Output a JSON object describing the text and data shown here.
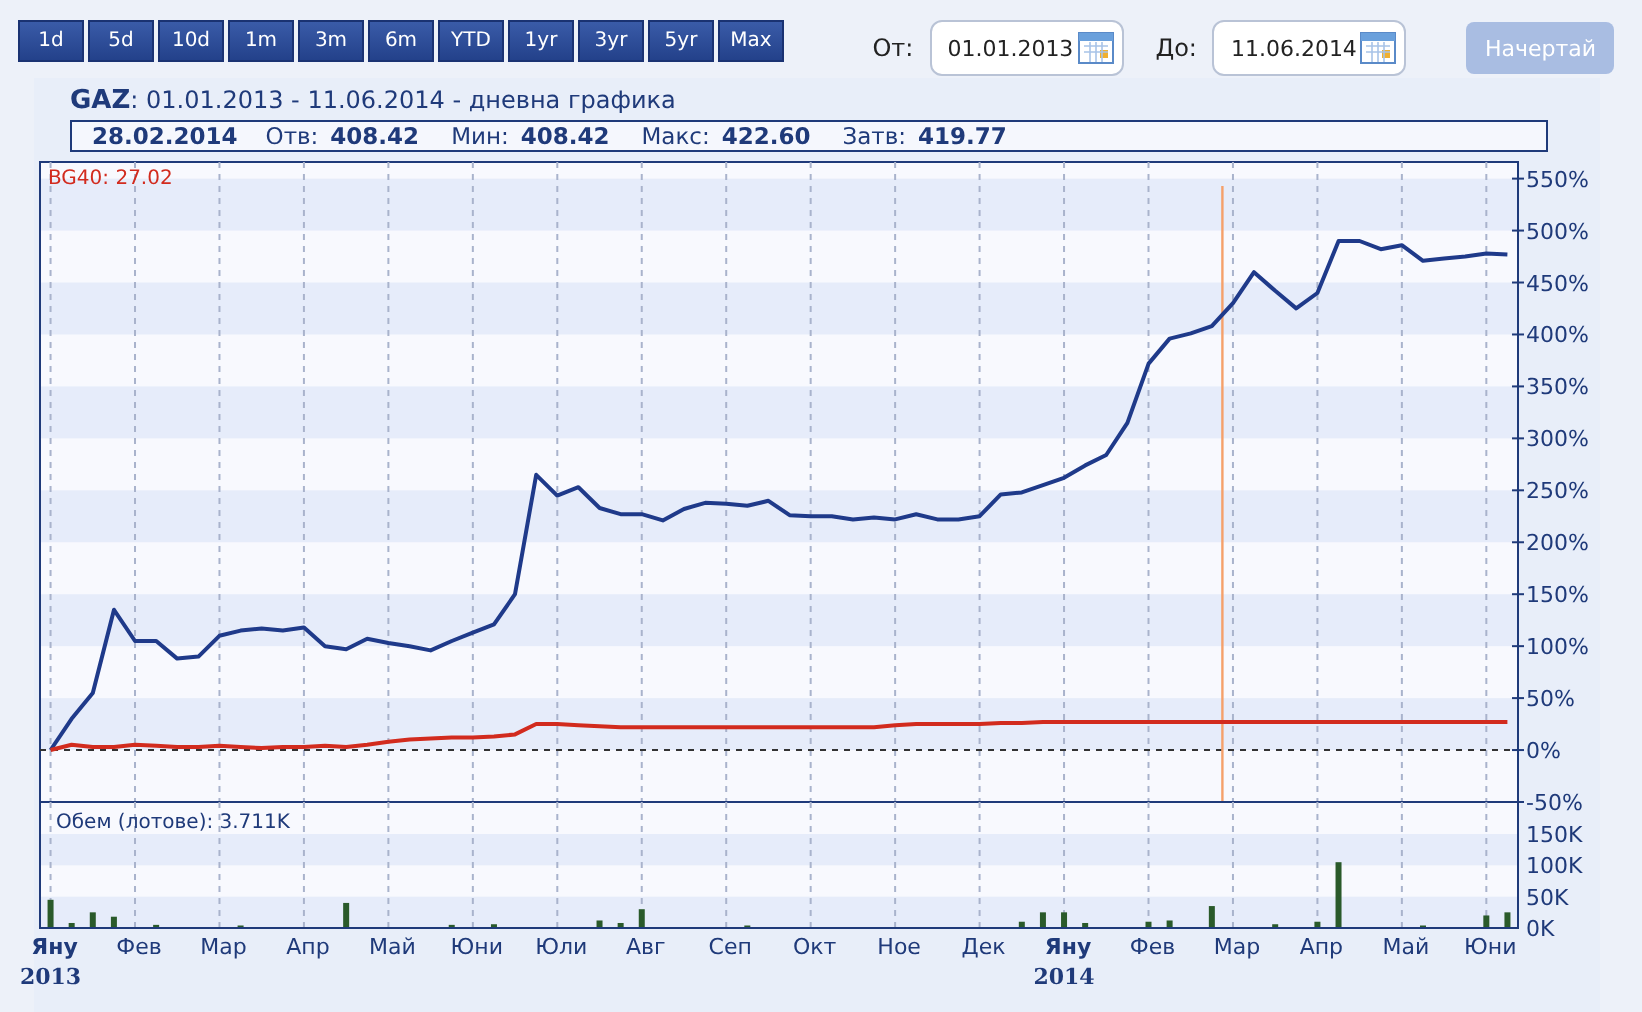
{
  "periods": [
    {
      "label": "1d",
      "selected": false
    },
    {
      "label": "5d",
      "selected": false
    },
    {
      "label": "10d",
      "selected": false
    },
    {
      "label": "1m",
      "selected": false
    },
    {
      "label": "3m",
      "selected": false
    },
    {
      "label": "6m",
      "selected": false
    },
    {
      "label": "YTD",
      "selected": false
    },
    {
      "label": "1yr",
      "selected": false
    },
    {
      "label": "3yr",
      "selected": false
    },
    {
      "label": "5yr",
      "selected": false
    },
    {
      "label": "Max",
      "selected": false
    }
  ],
  "date_from": {
    "label": "От:",
    "value": "01.01.2013"
  },
  "date_to": {
    "label": "До:",
    "value": "11.06.2014"
  },
  "draw_button": {
    "label": "Начертай",
    "disabled": true
  },
  "title_suffix": ": 01.01.2013 - 11.06.2014 - дневна графика",
  "info": {
    "date": "28.02.2014",
    "fields": [
      {
        "label": "Отв:",
        "value": "408.42"
      },
      {
        "label": "Мин:",
        "value": "408.42"
      },
      {
        "label": "Макс:",
        "value": "422.60"
      },
      {
        "label": "Затв:",
        "value": "419.77"
      }
    ]
  },
  "legend": {
    "value": ": 27.02"
  },
  "volume_legend": "Обем (лотове): 3.711K",
  "years": [
    "2013",
    "2014"
  ],
  "price_chart": {
    "chart_data": {
      "type": "line",
      "ylim": [
        -50,
        566
      ],
      "categories": [
        "Яну",
        null,
        null,
        null,
        "Фев",
        null,
        null,
        null,
        "Мар",
        null,
        null,
        null,
        "Апр",
        null,
        null,
        null,
        "Май",
        null,
        null,
        null,
        "Юни",
        null,
        null,
        null,
        "Юли",
        null,
        null,
        null,
        "Авг",
        null,
        null,
        null,
        "Сеп",
        null,
        null,
        null,
        "Окт",
        null,
        null,
        null,
        "Ное",
        null,
        null,
        null,
        "Дек",
        null,
        null,
        null,
        "Яну",
        null,
        null,
        null,
        "Фев",
        null,
        null,
        null,
        "Мар",
        null,
        null,
        null,
        "Апр",
        null,
        null,
        null,
        "Май",
        null,
        null,
        null,
        "Юни",
        null
      ],
      "yticks": [
        {
          "value": 550,
          "label": "550%"
        },
        {
          "value": 500,
          "label": "500%"
        },
        {
          "value": 450,
          "label": "450%"
        },
        {
          "value": 400,
          "label": "400%"
        },
        {
          "value": 350,
          "label": "350%"
        },
        {
          "value": 300,
          "label": "300%"
        },
        {
          "value": 250,
          "label": "250%"
        },
        {
          "value": 200,
          "label": "200%"
        },
        {
          "value": 150,
          "label": "150%"
        },
        {
          "value": 100,
          "label": "100%"
        },
        {
          "value": 50,
          "label": "50%"
        },
        {
          "value": 0,
          "label": "0%"
        },
        {
          "value": -50,
          "label": "-50%"
        }
      ],
      "series": [
        {
          "name": "GAZ",
          "color": "#1f3a8a",
          "values": [
            0,
            30,
            55,
            135,
            105,
            105,
            88,
            90,
            110,
            115,
            117,
            115,
            118,
            100,
            97,
            107,
            103,
            100,
            96,
            105,
            113,
            121,
            150,
            265,
            245,
            253,
            233,
            227,
            227,
            221,
            232,
            238,
            237,
            235,
            240,
            226,
            225,
            225,
            222,
            224,
            222,
            227,
            222,
            222,
            225,
            246,
            248,
            255,
            262,
            274,
            284,
            315,
            372,
            396,
            401,
            408,
            430,
            460,
            442,
            425,
            440,
            490,
            490,
            482,
            486,
            471,
            473,
            475,
            478,
            477
          ]
        },
        {
          "name": "BG40",
          "color": "#d22b1e",
          "values": [
            0,
            5,
            3,
            3,
            5,
            4,
            3,
            3,
            4,
            3,
            2,
            3,
            3,
            4,
            3,
            5,
            8,
            10,
            11,
            12,
            12,
            13,
            15,
            25,
            25,
            24,
            23,
            22,
            22,
            22,
            22,
            22,
            22,
            22,
            22,
            22,
            22,
            22,
            22,
            22,
            24,
            25,
            25,
            25,
            25,
            26,
            26,
            27,
            27,
            27,
            27,
            27,
            27,
            27,
            27,
            27,
            27,
            27,
            27,
            27,
            27,
            27,
            27,
            27,
            27,
            27,
            27,
            27,
            27,
            27
          ]
        }
      ],
      "grid": true,
      "ref_lines": [
        {
          "axis": "y",
          "value": 0
        }
      ]
    }
  },
  "volume_chart": {
    "chart_data": {
      "type": "bar",
      "ylim": [
        0,
        150000
      ],
      "grid": true,
      "categories": [
        null,
        null,
        null,
        null,
        null,
        null,
        null,
        null,
        null,
        null,
        null,
        null,
        null,
        null,
        null,
        null,
        null,
        null,
        null,
        null,
        null,
        null,
        null,
        null,
        null,
        null,
        null,
        null,
        null,
        null,
        null,
        null,
        null,
        null,
        null,
        null,
        null,
        null,
        null,
        null,
        null,
        null,
        null,
        null,
        null,
        null,
        null,
        null,
        null,
        null,
        null,
        null,
        null,
        null,
        null,
        null,
        null,
        null,
        null,
        null,
        null,
        null,
        null,
        null,
        null,
        null,
        null,
        null,
        null,
        null
      ],
      "yticks": [
        {
          "value": 150000,
          "label": "150K"
        },
        {
          "value": 100000,
          "label": "100K"
        },
        {
          "value": 50000,
          "label": "50K"
        },
        {
          "value": 0,
          "label": "0K"
        }
      ],
      "values": [
        45000,
        8000,
        25000,
        18000,
        null,
        5000,
        null,
        null,
        null,
        4000,
        null,
        null,
        null,
        null,
        40000,
        null,
        null,
        null,
        null,
        5000,
        null,
        6000,
        null,
        null,
        null,
        null,
        12000,
        8000,
        30000,
        null,
        null,
        null,
        null,
        4000,
        null,
        null,
        null,
        null,
        null,
        null,
        null,
        null,
        null,
        null,
        null,
        null,
        10000,
        25000,
        25000,
        8000,
        null,
        null,
        10000,
        12000,
        null,
        35000,
        null,
        null,
        6000,
        null,
        10000,
        105000,
        null,
        null,
        null,
        4000,
        null,
        null,
        20000,
        25000
      ]
    }
  }
}
